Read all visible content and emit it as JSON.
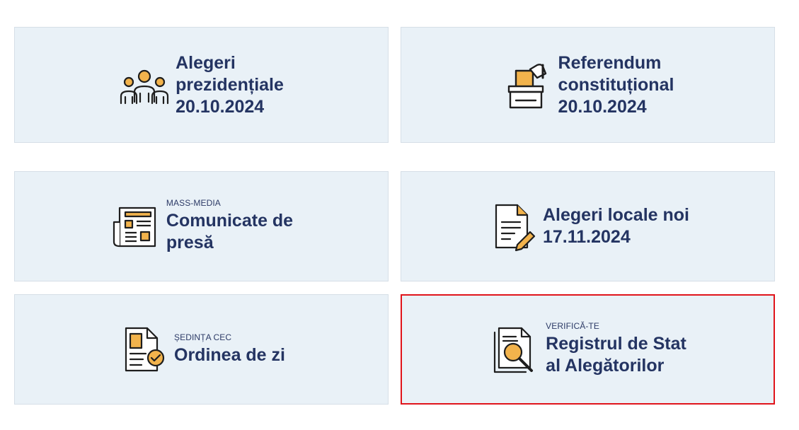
{
  "cards": [
    {
      "icon": "people-group-icon",
      "kicker": "",
      "title": "Alegeri\nprezidențiale\n20.10.2024"
    },
    {
      "icon": "ballot-box-icon",
      "kicker": "",
      "title": "Referendum\nconstituțional\n20.10.2024"
    },
    {
      "icon": "newspaper-icon",
      "kicker": "MASS-MEDIA",
      "title": "Comunicate de\npresă"
    },
    {
      "icon": "document-edit-icon",
      "kicker": "",
      "title": "Alegeri locale noi\n17.11.2024"
    },
    {
      "icon": "document-check-icon",
      "kicker": "ȘEDINȚA CEC",
      "title": "Ordinea de zi"
    },
    {
      "icon": "document-search-icon",
      "kicker": "VERIFICĂ-TE",
      "title": "Registrul de Stat\nal Alegătorilor"
    }
  ],
  "colors": {
    "card_bg": "#e9f1f7",
    "title": "#243462",
    "accent": "#f2b34c",
    "highlight": "#e0141b"
  }
}
